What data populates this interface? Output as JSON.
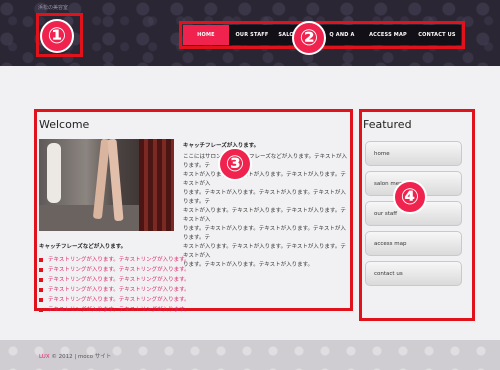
{
  "header": {
    "tagline": "浜松の美容室",
    "logo_badge": "①",
    "nav_badge": "②",
    "nav": [
      {
        "label": "HOME",
        "active": true
      },
      {
        "label": "OUR STAFF",
        "active": false
      },
      {
        "label": "SALON MENU",
        "active": false
      },
      {
        "label": "Q AND A",
        "active": false
      },
      {
        "label": "ACCESS MAP",
        "active": false
      },
      {
        "label": "CONTACT US",
        "active": false
      }
    ]
  },
  "main": {
    "title": "Welcome",
    "badge": "③",
    "catch_heading": "キャッチフレーズが入ります。",
    "body_lines": [
      "ここにはサロンのキャッチフレーズなどが入ります。テキストが入ります。テ",
      "キストが入ります。テキストが入ります。テキストが入ります。テキストが入",
      "ります。テキストが入ります。テキストが入ります。テキストが入ります。テ",
      "キストが入ります。テキストが入ります。テキストが入ります。テキストが入",
      "ります。テキストが入ります。テキストが入ります。テキストが入ります。テ",
      "キストが入ります。テキストが入ります。テキストが入ります。テキストが入",
      "ります。テキストが入ります。テキストが入ります。"
    ],
    "list_heading": "キャッチフレーズなどが入ります。",
    "list_items": [
      "テキストリングが入ります。テキストリングが入ります。",
      "テキストリングが入ります。テキストリングが入ります。",
      "テキストリングが入ります。テキストリングが入ります。",
      "テキストリングが入ります。テキストリングが入ります。",
      "テキストリングが入ります。テキストリングが入ります。",
      "テキストリングが入ります。テキストリングが入ります。"
    ]
  },
  "sidebar": {
    "title": "Featured",
    "badge": "④",
    "items": [
      "home",
      "salon menu",
      "our staff",
      "access map",
      "contact us"
    ]
  },
  "footer": {
    "brand": "LUX",
    "text": " © 2012 | moco サイト"
  },
  "colors": {
    "accent": "#f0234f",
    "annotation": "#e0121b",
    "link": "#e0246a"
  }
}
